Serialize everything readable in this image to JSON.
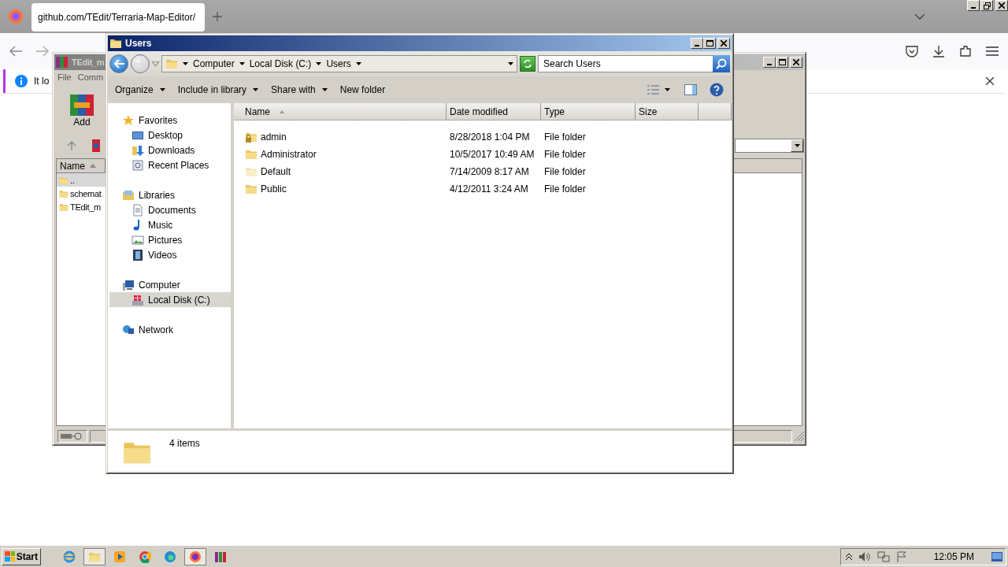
{
  "browser": {
    "tabs": [
      {
        "title": "github.com/TEdit/Terraria-Map-Editor/",
        "selected": true
      }
    ],
    "notification": {
      "text": "It lo"
    }
  },
  "archiver_window": {
    "title": "TEdit_m",
    "menu": [
      "File",
      "Comm"
    ],
    "toolbar": [
      {
        "label": "Add"
      }
    ],
    "list": {
      "column": "Name",
      "rows": [
        {
          "name": "..",
          "selected": true
        },
        {
          "name": "schemat",
          "selected": false
        },
        {
          "name": "TEdit_m",
          "selected": false
        }
      ]
    }
  },
  "explorer": {
    "title": "Users",
    "breadcrumb": [
      "Computer",
      "Local Disk (C:)",
      "Users"
    ],
    "search": {
      "placeholder": "Search Users"
    },
    "commands": [
      {
        "label": "Organize",
        "dropdown": true
      },
      {
        "label": "Include in library",
        "dropdown": true
      },
      {
        "label": "Share with",
        "dropdown": true
      },
      {
        "label": "New folder",
        "dropdown": false
      }
    ],
    "navigation": [
      {
        "label": "Favorites",
        "kind": "star",
        "selected": false,
        "children": [
          {
            "label": "Desktop",
            "kind": "desktop",
            "selected": false
          },
          {
            "label": "Downloads",
            "kind": "downloads",
            "selected": false
          },
          {
            "label": "Recent Places",
            "kind": "recent",
            "selected": false
          }
        ]
      },
      {
        "label": "Libraries",
        "kind": "libraries",
        "selected": false,
        "children": [
          {
            "label": "Documents",
            "kind": "documents",
            "selected": false
          },
          {
            "label": "Music",
            "kind": "music",
            "selected": false
          },
          {
            "label": "Pictures",
            "kind": "pictures",
            "selected": false
          },
          {
            "label": "Videos",
            "kind": "videos",
            "selected": false
          }
        ]
      },
      {
        "label": "Computer",
        "kind": "computer",
        "selected": false,
        "children": [
          {
            "label": "Local Disk (C:)",
            "kind": "disk",
            "selected": true
          }
        ]
      },
      {
        "label": "Network",
        "kind": "network",
        "selected": false
      }
    ],
    "columns": [
      {
        "label": "Name",
        "sorted": true
      },
      {
        "label": "Date modified",
        "sorted": false
      },
      {
        "label": "Type",
        "sorted": false
      },
      {
        "label": "Size",
        "sorted": false
      }
    ],
    "rows": [
      {
        "name": "admin",
        "date": "8/28/2018 1:04 PM",
        "type": "File folder",
        "locked": true,
        "hidden": false
      },
      {
        "name": "Administrator",
        "date": "10/5/2017 10:49 AM",
        "type": "File folder",
        "locked": false,
        "hidden": false
      },
      {
        "name": "Default",
        "date": "7/14/2009 8:17 AM",
        "type": "File folder",
        "locked": false,
        "hidden": true
      },
      {
        "name": "Public",
        "date": "4/12/2011 3:24 AM",
        "type": "File folder",
        "locked": false,
        "hidden": false
      }
    ],
    "status": "4 items"
  },
  "taskbar": {
    "start": "Start",
    "apps": [
      {
        "kind": "ie",
        "active": false
      },
      {
        "kind": "explorer",
        "active": true
      },
      {
        "kind": "media",
        "active": false
      },
      {
        "kind": "chrome",
        "active": false
      },
      {
        "kind": "edge",
        "active": false
      },
      {
        "kind": "firefox",
        "active": true
      },
      {
        "kind": "archiver",
        "active": false
      }
    ],
    "clock": "12:05 PM"
  }
}
